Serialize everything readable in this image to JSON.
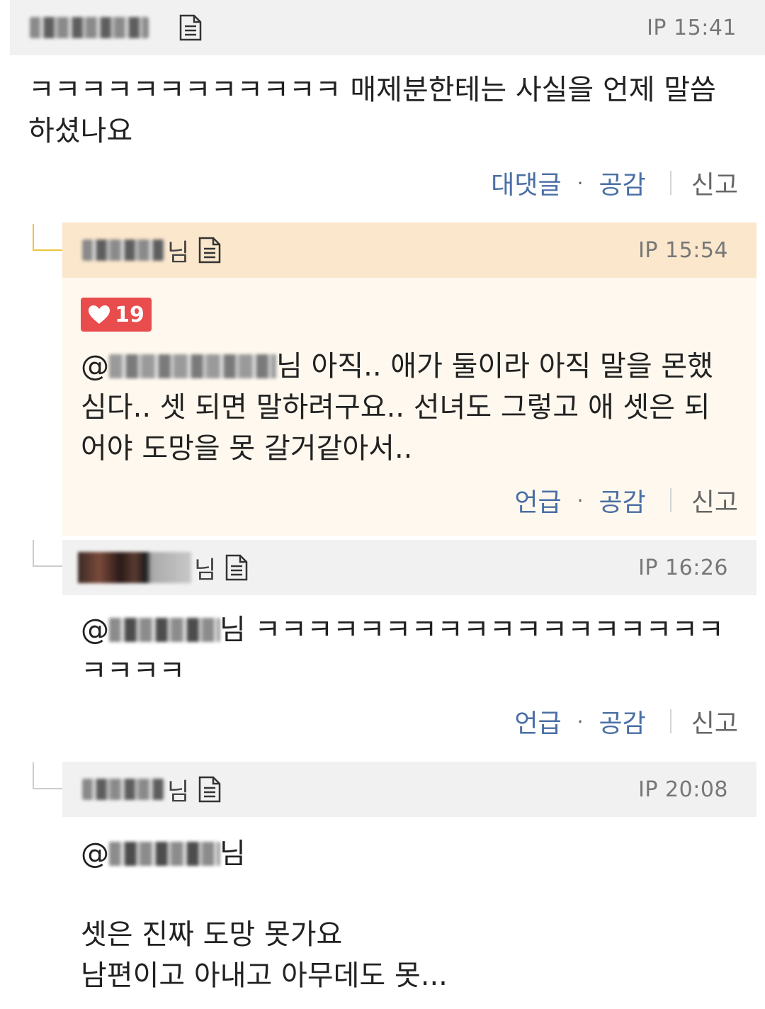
{
  "comments": [
    {
      "suffix": "",
      "time": "IP 15:41",
      "text": "ㅋㅋㅋㅋㅋㅋㅋㅋㅋㅋㅋㅋ 매제분한테는 사실을 언제 말씀\n하셨나요",
      "actions": {
        "reply": "대댓글",
        "dot": "·",
        "like": "공감",
        "report": "신고"
      }
    },
    {
      "suffix": "님",
      "time": "IP 15:54",
      "likes": "19",
      "mention_at": "@",
      "mention_suffix": "님",
      "text_first": " 아직.. 애가 둘이라 아직 말을 몬했",
      "text_rest": "심다.. 셋 되면 말하려구요.. 선녀도 그렇고 애 셋은 되\n어야 도망을 못 갈거같아서..",
      "actions": {
        "reply": "언급",
        "dot": "·",
        "like": "공감",
        "report": "신고"
      }
    },
    {
      "suffix": "님",
      "time": "IP 16:26",
      "mention_at": "@",
      "mention_suffix": "님",
      "text_first": " ㅋㅋㅋㅋㅋㅋㅋㅋㅋㅋㅋㅋㅋㅋㅋㅋㅋㅋ",
      "text_rest": "ㅋㅋㅋㅋ",
      "actions": {
        "reply": "언급",
        "dot": "·",
        "like": "공감",
        "report": "신고"
      }
    },
    {
      "suffix": "님",
      "time": "IP 20:08",
      "mention_at": "@",
      "mention_suffix": "님",
      "text_rest": "셋은 진짜 도망 못가요\n남편이고 아내고 아무데도 못..."
    }
  ],
  "colors": {
    "header_gray": "#f1f1f1",
    "header_highlight": "#fbe7cc",
    "highlight_body": "#fff8ee",
    "link_blue": "#4a6fa5",
    "like_red": "#e84c4c"
  },
  "icons": {
    "document": "document-icon",
    "heart": "heart-icon"
  }
}
